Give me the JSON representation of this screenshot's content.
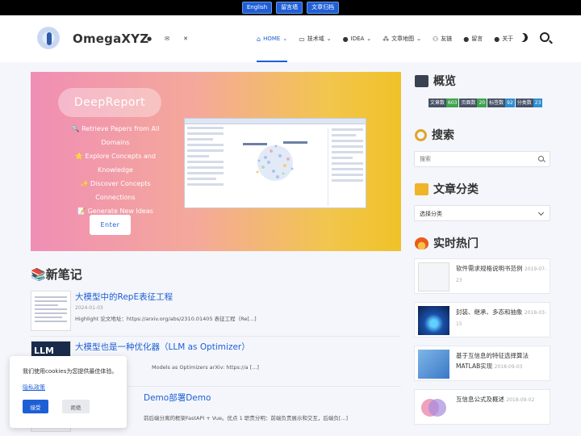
{
  "topstrip": {
    "buttons": [
      "English",
      "留言墙",
      "文章归档"
    ]
  },
  "header": {
    "site_name": "OmegaXYZ",
    "icons": [
      "github-icon",
      "email-icon",
      "x-icon"
    ],
    "nav": [
      {
        "icon": "home-icon",
        "label": "HOME",
        "caret": "⌄",
        "active": true
      },
      {
        "icon": "book-icon",
        "label": "技术域",
        "caret": "⌄",
        "active": false
      },
      {
        "icon": "palette-icon",
        "label": "IDEA",
        "caret": "⌄",
        "active": false
      },
      {
        "icon": "map-icon",
        "label": "文章地图",
        "caret": "⌄",
        "active": false
      },
      {
        "icon": "friends-icon",
        "label": "友链",
        "caret": "",
        "active": false
      },
      {
        "icon": "comment-icon",
        "label": "留言",
        "caret": "",
        "active": false
      },
      {
        "icon": "user-icon",
        "label": "关于",
        "caret": "",
        "active": false
      }
    ]
  },
  "banner": {
    "title": "DeepReport",
    "lines": [
      {
        "icon": "🔍",
        "text": "Retrieve Papers from All Domains"
      },
      {
        "icon": "⭐",
        "text": "Explore Concepts and Knowledge"
      },
      {
        "icon": "✨",
        "text": "Discover Concepts Connections"
      },
      {
        "icon": "📝",
        "text": "Generate New Ideas"
      }
    ],
    "enter_label": "Enter"
  },
  "notes": {
    "title": "新笔记",
    "icon": "📚",
    "items": [
      {
        "title": "大模型中的RepE表征工程",
        "date": "2024-01-03",
        "summary": "Highlight 论文地址：https://arxiv.org/abs/2310.01405 表征工程（Re[...]"
      },
      {
        "title": "大模型也是一种优化器（LLM as Optimizer）",
        "thumb_text": "LLM",
        "date": "",
        "summary": "Models as Optimizers arXiv: https://a [...]"
      },
      {
        "title": "Demo部署Demo",
        "date": "",
        "summary": "前后端分离的框架FastAPI + Vue。优点 1 职责分明：前端负责展示和交互，后端负[...]"
      }
    ]
  },
  "cookie": {
    "text": "我们使用cookies为您提供最佳体验。",
    "policy_link": "隐私政策",
    "accept": "接受",
    "reject": "拒绝"
  },
  "sidebar": {
    "overview": {
      "title": "概览",
      "stats": [
        {
          "label": "文章数",
          "value": "603",
          "color": "#3fa34d"
        },
        {
          "label": "页面数",
          "value": "20",
          "color": "#3fa34d"
        },
        {
          "label": "标签数",
          "value": "92",
          "color": "#2f8fcf"
        },
        {
          "label": "分类数",
          "value": "23",
          "color": "#2f8fcf"
        }
      ]
    },
    "search": {
      "title": "搜索",
      "placeholder": "搜索"
    },
    "categories": {
      "title": "文章分类",
      "selected": "选择分类"
    },
    "hot": {
      "title": "实时热门",
      "items": [
        {
          "title": "软件需求规格说明书范例",
          "date": "2019-07-23"
        },
        {
          "title": "封装、继承、多态和抽象",
          "date": "2018-03-15"
        },
        {
          "title": "基于互信息的特征选择算法MATLAB实现",
          "date": "2018-09-03"
        },
        {
          "title": "互信息公式及概述",
          "date": "2018-09-02"
        }
      ]
    }
  }
}
